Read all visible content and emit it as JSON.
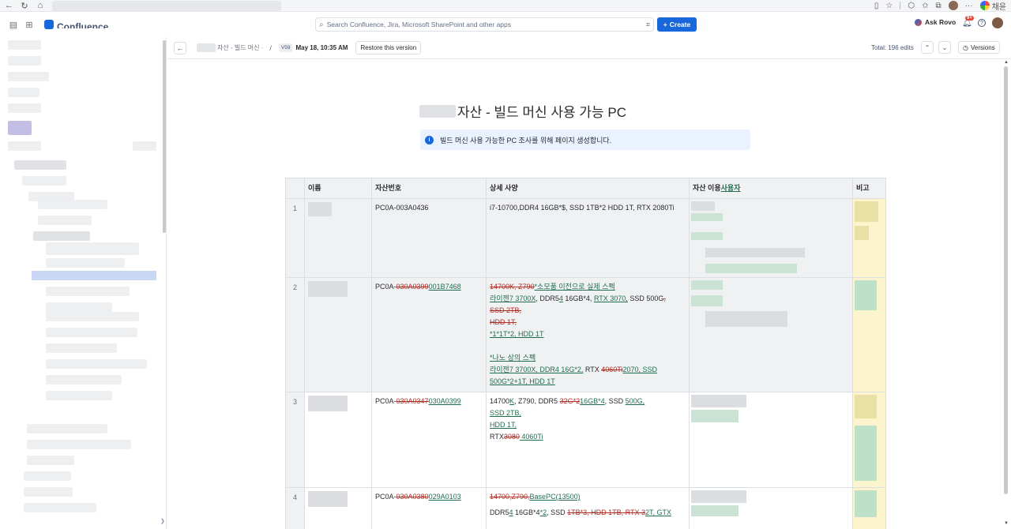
{
  "browser": {
    "profile_name": "채윤"
  },
  "topnav": {
    "app_name": "Confluence",
    "search_placeholder": "Search Confluence, Jira, Microsoft SharePoint and other apps",
    "create_label": "Create",
    "rovo_label": "Ask Rovo",
    "notification_badge": "9+"
  },
  "toolbar": {
    "breadcrumb": "자산 - 빌드 머신 ·",
    "version_chip": "V59",
    "version_date": "May 18, 10:35 AM",
    "restore_label": "Restore this version",
    "total_edits": "Total: 196 edits",
    "versions_label": "Versions"
  },
  "page": {
    "title": "자산 - 빌드 머신 사용 가능 PC",
    "info_text": "빌드 머신 사용 가능한 PC 조사를 위해 페이지 생성합니다."
  },
  "table": {
    "headers": {
      "name": "이름",
      "asset_no": "자산번호",
      "spec": "상세 사양",
      "user_prefix": "자산 이용",
      "user_suffix": "사용자",
      "note": "비고"
    },
    "rows": [
      {
        "num": "1",
        "asset_plain": "PC0A-003A0436",
        "spec": "i7-10700,DDR4 16GB*$, SSD 1TB*2 HDD 1T, RTX 2080Ti"
      },
      {
        "num": "2",
        "asset_prefix": "PC0A-",
        "asset_del": "030A0399",
        "asset_ins": "001B7468",
        "spec_l1_del": "14700K, Z790",
        "spec_l1_ins": "*소모품 이전으로 실제 스펙",
        "spec_l2_ins": "라이젠7 3700X",
        "spec_l2_a": ", DDR5",
        "spec_l2_ins2": "4",
        "spec_l2_b": " 16GB*4, ",
        "spec_l2_ins3": "RTX 3070,",
        "spec_l2_c": " SSD 500G",
        "spec_l2_del": ",",
        "spec_l3_del": "SSD 2TB,",
        "spec_l4_del": "HDD 1T,",
        "spec_l5_ins": "*1*1T*2, HDD 1T",
        "spec_l6_ins": "*나노 상의 스펙",
        "spec_l7_ins": "라이젠7 3700X, DDR4 16G*2,",
        "spec_l7_a": " RTX ",
        "spec_l7_del": "4060Ti",
        "spec_l7_ins2": "2070, SSD",
        "spec_l8_ins": "500G*2+1T, HDD 1T"
      },
      {
        "num": "3",
        "asset_prefix": "PC0A-",
        "asset_del": "030A0347",
        "asset_ins": "030A0399",
        "spec_l1_a": "14700",
        "spec_l1_ins": "K",
        "spec_l1_b": ", Z790, DDR5 ",
        "spec_l1_del": "32G*2",
        "spec_l1_ins2": "16GB*4",
        "spec_l1_c": ", SSD ",
        "spec_l1_ins3": "500G,",
        "spec_l2_ins": "SSD 2TB,",
        "spec_l3_ins": "HDD 1T,",
        "spec_l4_a": "RTX",
        "spec_l4_del": "3080",
        "spec_l4_ins": " 4060Ti"
      },
      {
        "num": "4",
        "asset_prefix": "PC0A-",
        "asset_del": "030A0380",
        "asset_ins": "029A0103",
        "spec_l1_del": "14700,Z790,",
        "spec_l1_ins": "BasePC(13500)",
        "spec_l2_a": "DDR5",
        "spec_l2_ins": "4",
        "spec_l2_b": " 16GB*4",
        "spec_l2_ins2": "*2",
        "spec_l2_c": ", SSD ",
        "spec_l2_del": "1TB*3, HDD 1TB, RTX 3",
        "spec_l2_ins3": "2T, GTX"
      }
    ]
  }
}
